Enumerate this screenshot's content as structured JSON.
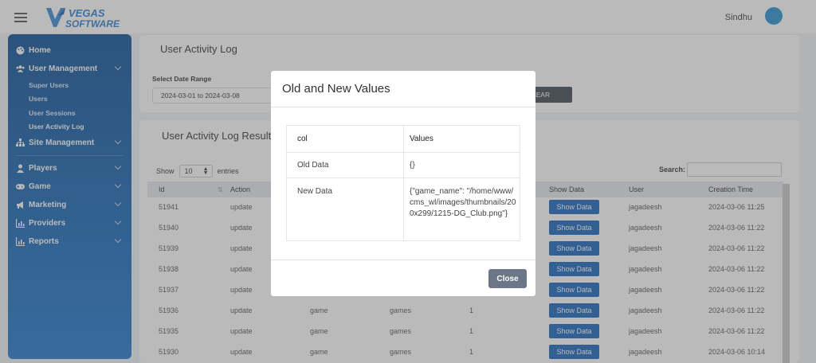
{
  "header": {
    "brand_line1": "VEGAS",
    "brand_line2": "SOFTWARE",
    "user_name": "Sindhu"
  },
  "sidebar": {
    "items": [
      {
        "label": "Home",
        "icon": "palette-icon"
      },
      {
        "label": "User Management",
        "icon": "users-icon"
      },
      {
        "label": "Site Management",
        "icon": "sitemap-icon"
      },
      {
        "label": "Players",
        "icon": "user-icon"
      },
      {
        "label": "Game",
        "icon": "gamepad-icon"
      },
      {
        "label": "Marketing",
        "icon": "bullhorn-icon"
      },
      {
        "label": "Providers",
        "icon": "chart-icon"
      },
      {
        "label": "Reports",
        "icon": "chart-icon"
      }
    ],
    "sub_items": [
      "Super Users",
      "Users",
      "User Sessions",
      "User Activity Log"
    ]
  },
  "filter_card": {
    "title": "User Activity Log",
    "date_label": "Select Date Range",
    "date_value": "2024-03-01 to 2024-03-08",
    "clear_label": "LEAR"
  },
  "results": {
    "title": "User Activity Log Result",
    "show_label": "Show",
    "entries_value": "10",
    "entries_label": "entries",
    "search_label": "Search:",
    "headers": {
      "id": "Id",
      "action": "Action",
      "show_data": "Show Data",
      "user": "User",
      "creation_time": "Creation Time"
    },
    "sort_glyph": "⇅",
    "button_label": "Show Data",
    "rows": [
      {
        "id": "51941",
        "action": "update",
        "col3": "",
        "col4": "",
        "col5": "",
        "user": "jagadeesh",
        "time": "2024-03-06 11:25"
      },
      {
        "id": "51940",
        "action": "update",
        "col3": "",
        "col4": "",
        "col5": "",
        "user": "jagadeesh",
        "time": "2024-03-06 11:22"
      },
      {
        "id": "51939",
        "action": "update",
        "col3": "",
        "col4": "",
        "col5": "",
        "user": "jagadeesh",
        "time": "2024-03-06 11:22"
      },
      {
        "id": "51938",
        "action": "update",
        "col3": "",
        "col4": "",
        "col5": "",
        "user": "jagadeesh",
        "time": "2024-03-06 11:22"
      },
      {
        "id": "51937",
        "action": "update",
        "col3": "",
        "col4": "",
        "col5": "",
        "user": "jagadeesh",
        "time": "2024-03-06 11:22"
      },
      {
        "id": "51936",
        "action": "update",
        "col3": "game",
        "col4": "games",
        "col5": "1",
        "user": "jagadeesh",
        "time": "2024-03-06 11:22"
      },
      {
        "id": "51935",
        "action": "update",
        "col3": "game",
        "col4": "games",
        "col5": "1",
        "user": "jagadeesh",
        "time": "2024-03-06 11:22"
      },
      {
        "id": "51930",
        "action": "update",
        "col3": "game",
        "col4": "games",
        "col5": "1",
        "user": "jagadeesh",
        "time": "2024-03-06 10:14"
      }
    ]
  },
  "modal": {
    "title": "Old and New Values",
    "col_header": "col",
    "values_header": "Values",
    "old_label": "Old Data",
    "old_value": "{}",
    "new_label": "New Data",
    "new_value": "{\"game_name\": \"/home/www/cms_wl/images/thumbnails/200x299/1215-DG_Club.png\"}",
    "close_label": "Close"
  },
  "colors": {
    "sidebar_top": "#0b4f96",
    "sidebar_bottom": "#1f77cf",
    "primary_button": "#1565c0",
    "close_button": "#6b7787",
    "avatar": "#2a8fd4"
  }
}
